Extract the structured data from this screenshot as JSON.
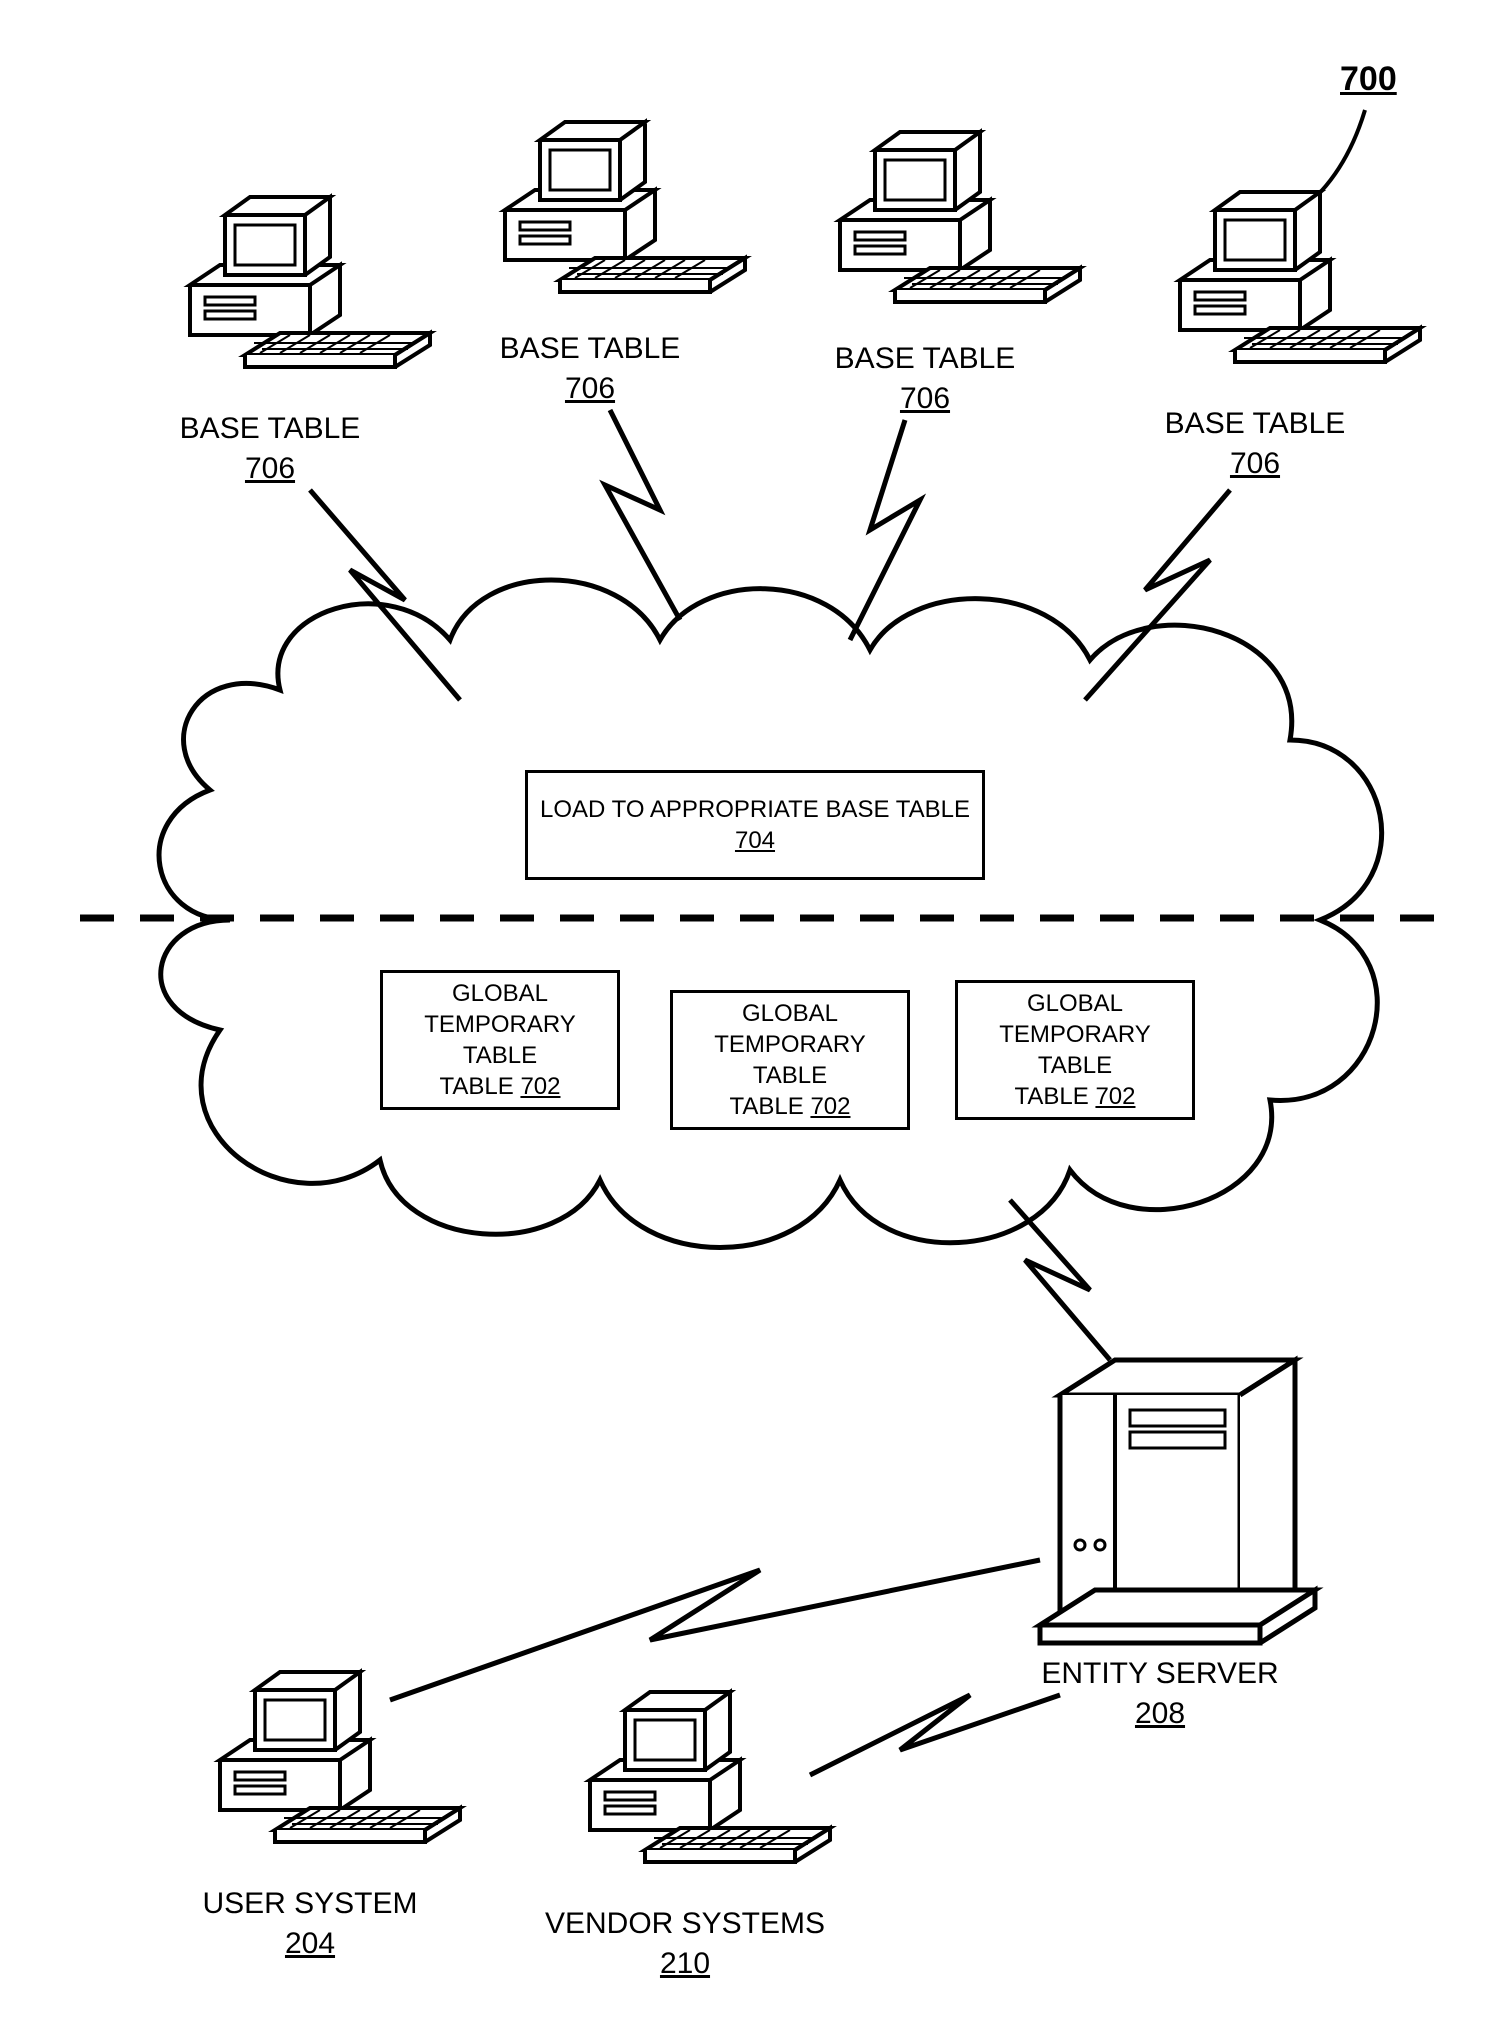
{
  "figure_ref": "700",
  "base_tables": [
    {
      "label": "BASE TABLE",
      "ref": "706"
    },
    {
      "label": "BASE TABLE",
      "ref": "706"
    },
    {
      "label": "BASE TABLE",
      "ref": "706"
    },
    {
      "label": "BASE TABLE",
      "ref": "706"
    }
  ],
  "cloud": {
    "load_box": {
      "text": "LOAD TO APPROPRIATE BASE TABLE",
      "ref": "704"
    },
    "gtt": [
      {
        "text": "GLOBAL TEMPORARY TABLE",
        "ref": "702"
      },
      {
        "text": "GLOBAL TEMPORARY TABLE",
        "ref": "702"
      },
      {
        "text": "GLOBAL TEMPORARY TABLE",
        "ref": "702"
      }
    ]
  },
  "entity_server": {
    "label": "ENTITY SERVER",
    "ref": "208"
  },
  "user_system": {
    "label": "USER SYSTEM",
    "ref": "204"
  },
  "vendor_systems": {
    "label": "VENDOR SYSTEMS",
    "ref": "210"
  }
}
